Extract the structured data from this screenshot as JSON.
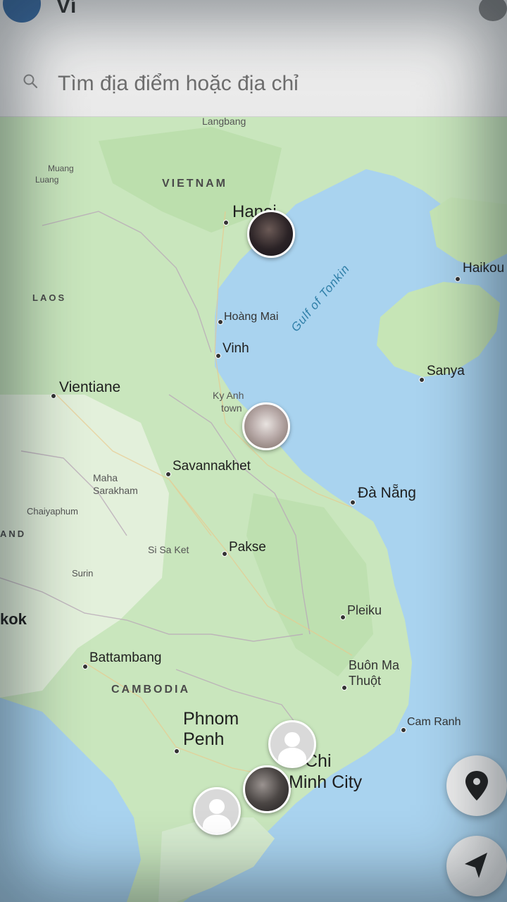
{
  "header": {
    "title": "Ví",
    "app_icon": "app-logo-icon"
  },
  "search": {
    "placeholder": "Tìm địa điểm hoặc địa chỉ",
    "icon": "search-icon"
  },
  "map": {
    "countries": {
      "vietnam": "VIETNAM",
      "laos": "LAOS",
      "cambodia": "CAMBODIA",
      "thailand_partial": "AND"
    },
    "water": {
      "gulf": "Gulf of Tonkin"
    },
    "places": {
      "langbang": "Langbang",
      "muang": "Muang",
      "luang": "Luang",
      "hanoi": "Hanoi",
      "haikou": "Haikou",
      "hoang_mai": "Hoàng Mai",
      "vinh": "Vinh",
      "sanya": "Sanya",
      "vientiane": "Vientiane",
      "ky_anh_1": "Ky Anh",
      "ky_anh_2": "town",
      "savannakhet": "Savannakhet",
      "da_nang": "Đà Nẵng",
      "maha_1": "Maha",
      "maha_2": "Sarakham",
      "chaiyaphum": "Chaiyaphum",
      "si_sa_ket": "Si Sa Ket",
      "pakse": "Pakse",
      "surin": "Surin",
      "pleiku": "Pleiku",
      "bangkok_partial": "kok",
      "battambang": "Battambang",
      "buon_ma_1": "Buôn Ma",
      "buon_ma_2": "Thuột",
      "cam_ranh": "Cam Ranh",
      "phnom_1": "Phnom",
      "phnom_2": "Penh",
      "hcmc_1": "Chi",
      "hcmc_2": "Minh City"
    }
  },
  "pins": [
    "user-avatar",
    "user-avatar",
    "default-avatar",
    "user-avatar",
    "default-avatar"
  ],
  "buttons": {
    "location_icon": "map-pin-icon",
    "navigate_icon": "navigation-arrow-icon"
  },
  "colors": {
    "land": "#cfe8c4",
    "land_green": "#b5dca5",
    "water": "#a8d2ef",
    "search_bar": "#eeeeee"
  }
}
